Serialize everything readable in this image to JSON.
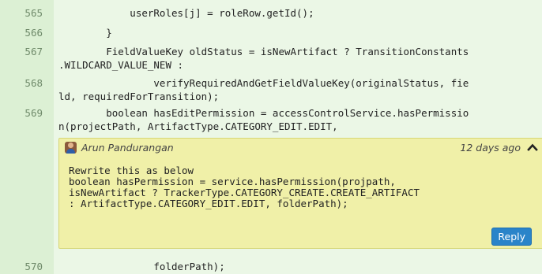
{
  "code_lines": [
    {
      "number": "565",
      "text": "            userRoles[j] = roleRow.getId();"
    },
    {
      "number": "566",
      "text": "        }"
    },
    {
      "number": "567",
      "text": "        FieldValueKey oldStatus = isNewArtifact ? TransitionConstants\n.WILDCARD_VALUE_NEW :"
    },
    {
      "number": "568",
      "text": "                verifyRequiredAndGetFieldValueKey(originalStatus, fie\nld, requiredForTransition);"
    },
    {
      "number": "569",
      "text": "        boolean hasEditPermission = accessControlService.hasPermissio\nn(projectPath, ArtifactType.CATEGORY_EDIT.EDIT,"
    },
    {
      "number": "570",
      "text": "                folderPath);"
    }
  ],
  "comment": {
    "author": "Arun Pandurangan",
    "timestamp": "12 days ago",
    "body": "Rewrite this as below\nboolean hasPermission = service.hasPermission(projpath,\nisNewArtifact ? TrackerType.CATEGORY_CREATE.CREATE_ARTIFACT\n: ArtifactType.CATEGORY_EDIT.EDIT, folderPath);",
    "reply_label": "Reply",
    "collapse_icon": "chevron-up-icon",
    "avatar_icon": "user-avatar"
  },
  "colors": {
    "code_background": "#ebf7e6",
    "gutter_background": "#dcf0d4",
    "comment_background": "#f0f0a8",
    "reply_button": "#2a84c9"
  }
}
